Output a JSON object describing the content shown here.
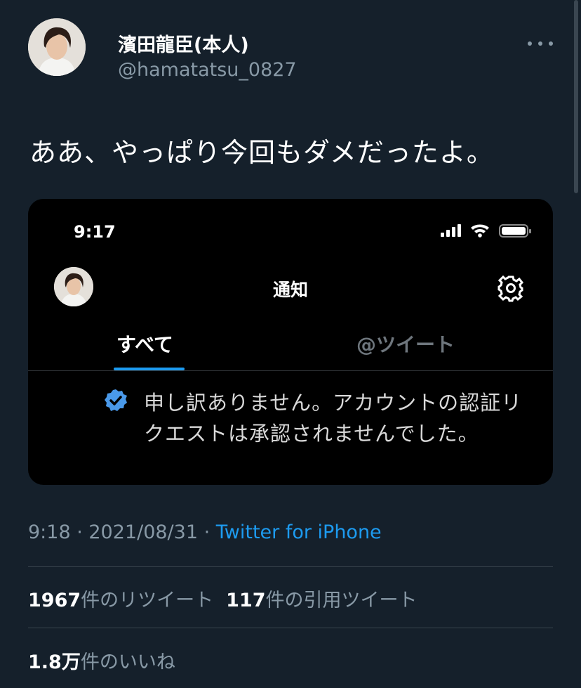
{
  "author": {
    "display_name": "濱田龍臣(本人)",
    "handle": "@hamatatsu_0827",
    "avatar_icon": "profile-photo"
  },
  "tweet": {
    "text": "ああ、やっぱり今回もダメだったよ。",
    "timestamp": "9:18 · 2021/08/31 · ",
    "source": "Twitter for iPhone"
  },
  "screenshot": {
    "time": "9:17",
    "title": "通知",
    "tabs": [
      "すべて",
      "@ツイート"
    ],
    "active_tab": "すべて",
    "notification": "申し訳ありません。アカウントの認証リクエストは承認されませんでした。",
    "icons": [
      "signal-icon",
      "wifi-icon",
      "battery-icon",
      "gear-icon",
      "verified-badge-icon"
    ]
  },
  "stats": {
    "retweet_count": "1967",
    "retweet_label": "件のリツイート",
    "quote_count": "117",
    "quote_label": "件の引用ツイート",
    "like_count": "1.8万",
    "like_label": "件のいいね"
  },
  "colors": {
    "background": "#15202b",
    "accent": "#1d9bf0",
    "muted": "#8899a6",
    "card": "#000000"
  }
}
